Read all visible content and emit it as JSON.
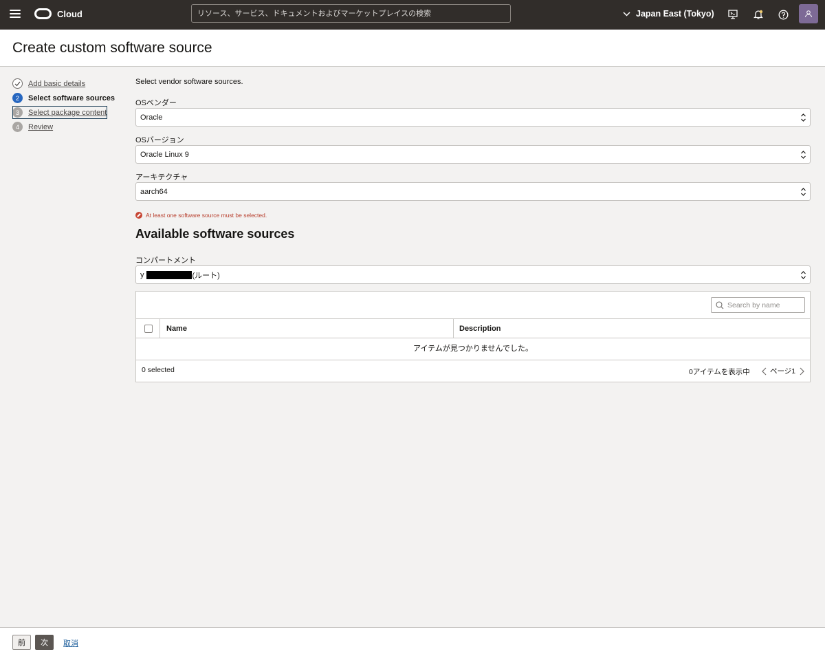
{
  "topbar": {
    "brand": "Cloud",
    "search_placeholder": "リソース、サービス、ドキュメントおよびマーケットプレイスの検索",
    "region": "Japan East (Tokyo)"
  },
  "page": {
    "title": "Create custom software source"
  },
  "steps": [
    {
      "num": "",
      "label": "Add basic details",
      "state": "done"
    },
    {
      "num": "2",
      "label": "Select software sources",
      "state": "current"
    },
    {
      "num": "3",
      "label": "Select package content",
      "state": "todo"
    },
    {
      "num": "4",
      "label": "Review",
      "state": "todo"
    }
  ],
  "form": {
    "intro": "Select vendor software sources.",
    "os_vendor": {
      "label": "OSベンダー",
      "value": "Oracle"
    },
    "os_version": {
      "label": "OSバージョン",
      "value": "Oracle Linux 9"
    },
    "arch": {
      "label": "アーキテクチャ",
      "value": "aarch64"
    },
    "error": "At least one software source must be selected."
  },
  "available": {
    "title": "Available software sources",
    "compartment": {
      "label": "コンパートメント",
      "prefix": "y",
      "suffix": "(ルート)"
    },
    "search_placeholder": "Search by name",
    "columns": {
      "name": "Name",
      "description": "Description"
    },
    "empty_message": "アイテムが見つかりませんでした。",
    "selected_count": "0 selected",
    "item_count": "0アイテムを表示中",
    "page_label": "ページ1"
  },
  "footer": {
    "prev": "前",
    "next": "次",
    "cancel": "取消"
  }
}
